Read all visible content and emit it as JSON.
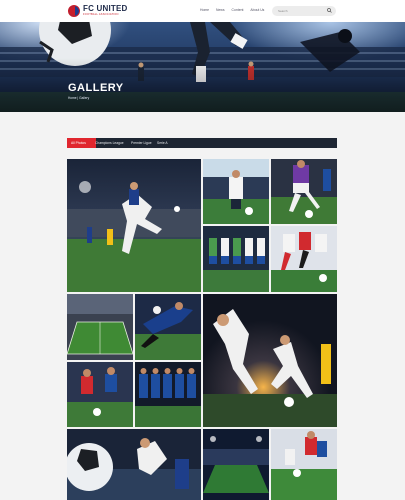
{
  "brand": {
    "name": "FC UNITED",
    "tagline": "FOOTBALL ASSOCIATION"
  },
  "nav": [
    "Home",
    "News",
    "Content",
    "About Us"
  ],
  "search": {
    "placeholder": "Search"
  },
  "hero": {
    "title": "GALLERY",
    "breadcrumb": "Home | Gallery"
  },
  "tabs": [
    {
      "label": "All Photos",
      "active": true
    },
    {
      "label": "Champions League",
      "active": false
    },
    {
      "label": "Premier Ligue",
      "active": false
    },
    {
      "label": "Serie A",
      "active": false
    }
  ],
  "colors": {
    "accent": "#e0262e",
    "tabbar": "#1e2633",
    "header": "#ffffff",
    "page": "#f3f3f3"
  },
  "gallery": [
    {
      "name": "photo-bicycle-kick-stadium"
    },
    {
      "name": "photo-player-kneeling-ball"
    },
    {
      "name": "photo-player-dribbling-purple"
    },
    {
      "name": "photo-team-lineup-green"
    },
    {
      "name": "photo-players-red-white"
    },
    {
      "name": "photo-stadium-aerial"
    },
    {
      "name": "photo-goalkeeper-dive"
    },
    {
      "name": "photo-night-match-action"
    },
    {
      "name": "photo-players-challenge"
    },
    {
      "name": "photo-team-lineup-blue"
    },
    {
      "name": "photo-ball-kick-night"
    },
    {
      "name": "photo-stadium-night"
    },
    {
      "name": "photo-youth-players"
    }
  ]
}
